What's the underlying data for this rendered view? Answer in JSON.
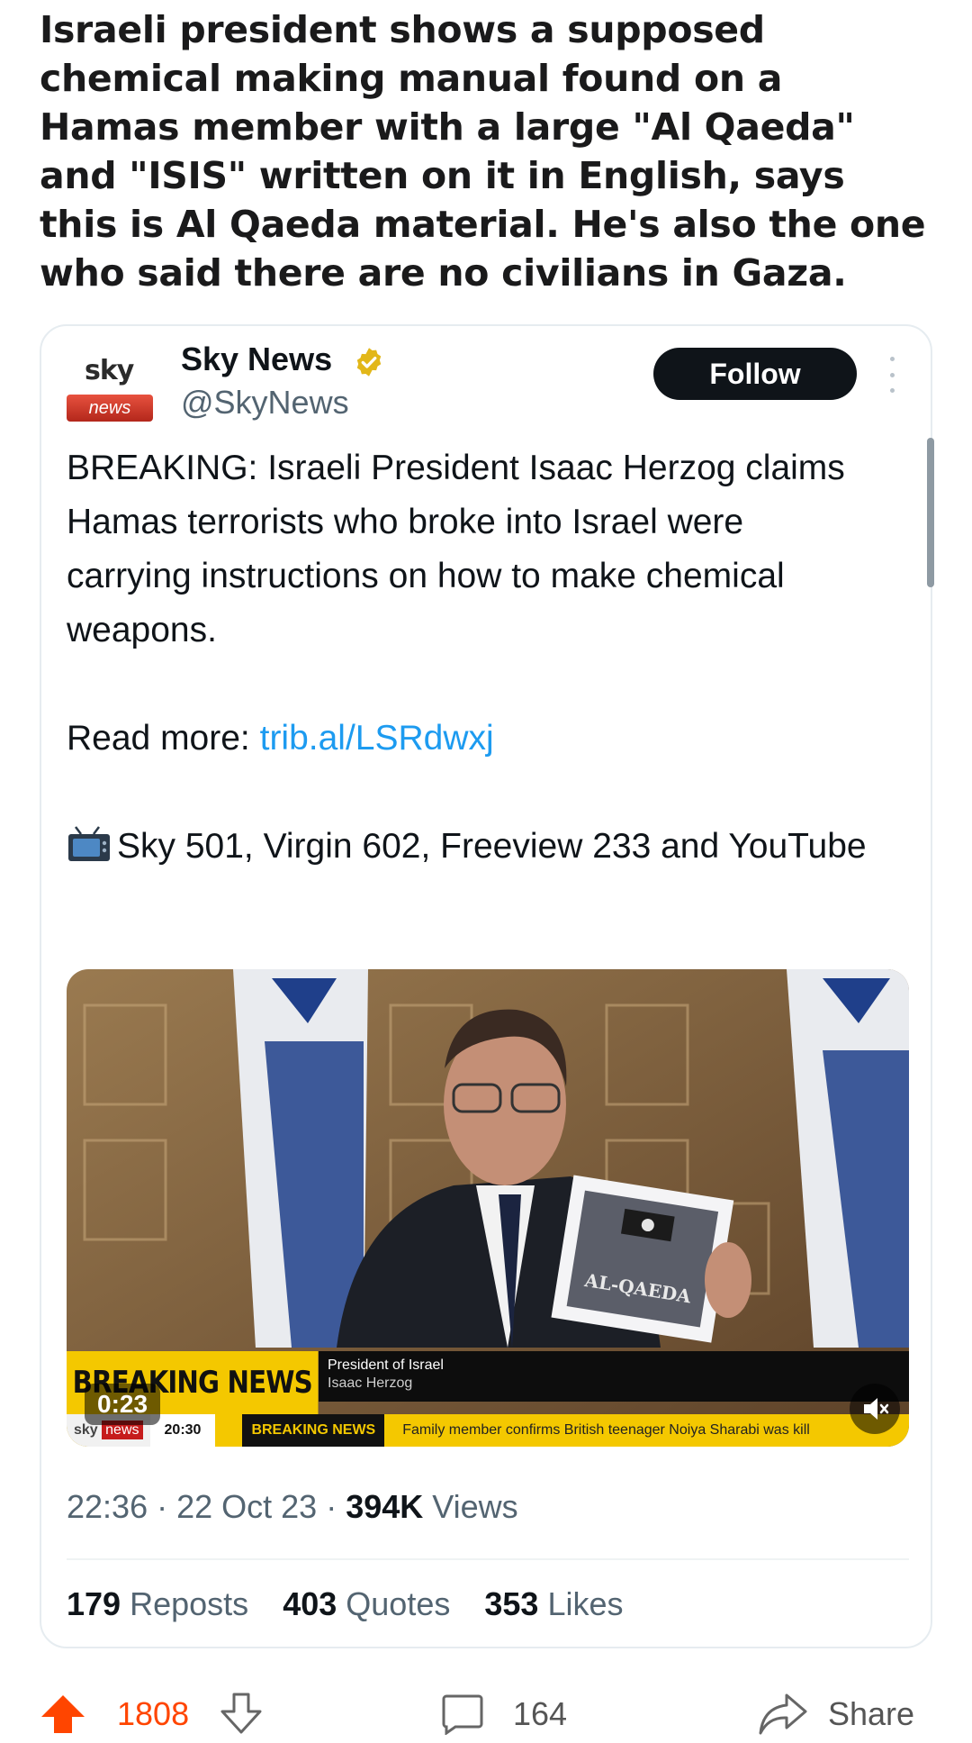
{
  "post": {
    "title": "Israeli president shows a supposed chemical making manual found on a Hamas member with a large \"Al Qaeda\" and \"ISIS\" written on it in English, says this is Al Qaeda material. He's also the one who said there are no civilians in Gaza."
  },
  "tweet": {
    "logo": {
      "sky": "sky",
      "news": "news"
    },
    "account_name": "Sky News",
    "handle": "@SkyNews",
    "follow_label": "Follow",
    "body_line1": "BREAKING: Israeli President Isaac Herzog claims Hamas terrorists who broke into Israel were carrying instructions on how to make chemical weapons.",
    "read_more_label": "Read more: ",
    "read_more_link": "trib.al/LSRdwxj",
    "channels": "Sky 501, Virgin 602, Freeview 233 and YouTube",
    "video": {
      "time": "0:23",
      "breaking_label": "BREAKING NEWS",
      "caption_title": "President of Israel",
      "caption_sub": "Isaac Herzog",
      "ticker_sky": "sky",
      "ticker_news": "news",
      "ticker_clock": "20:30",
      "ticker_breaking": "BREAKING NEWS",
      "ticker_text": "Family member confirms British teenager Noiya Sharabi was kill",
      "sheet_text": "AL-QAEDA"
    },
    "time": "22:36",
    "date": "22 Oct 23",
    "views_count": "394K",
    "views_label": "Views",
    "reposts_count": "179",
    "reposts_label": "Reposts",
    "quotes_count": "403",
    "quotes_label": "Quotes",
    "likes_count": "353",
    "likes_label": "Likes"
  },
  "actions": {
    "votes": "1808",
    "comments": "164",
    "share_label": "Share"
  },
  "colors": {
    "link": "#1d9bf0",
    "upvote": "#ff4500",
    "breaking_yellow": "#f4c800",
    "verified_gold": "#e2b719"
  },
  "icons": [
    "verified-icon",
    "more-icon",
    "tv-icon",
    "mute-icon",
    "upvote-icon",
    "downvote-icon",
    "comment-icon",
    "share-icon"
  ]
}
